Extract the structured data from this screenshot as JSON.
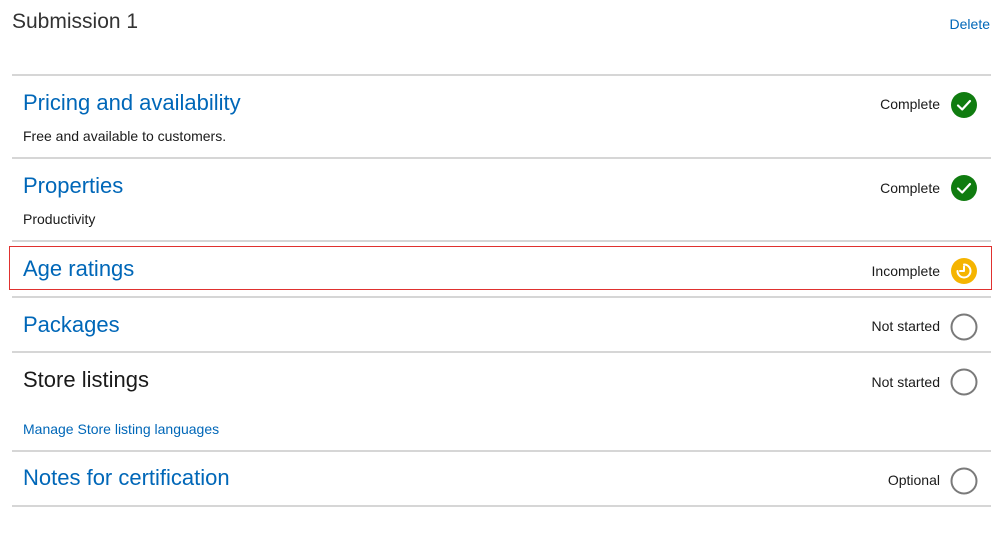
{
  "header": {
    "title": "Submission 1",
    "delete_label": "Delete"
  },
  "sections": [
    {
      "title": "Pricing and availability",
      "subtitle": "Free and available to customers.",
      "status": "Complete",
      "status_icon": "complete-check-icon"
    },
    {
      "title": "Properties",
      "subtitle": "Productivity",
      "status": "Complete",
      "status_icon": "complete-check-icon"
    },
    {
      "title": "Age ratings",
      "status": "Incomplete",
      "status_icon": "incomplete-clock-icon"
    },
    {
      "title": "Packages",
      "status": "Not started",
      "status_icon": "not-started-circle-icon"
    },
    {
      "title": "Store listings",
      "link": "Manage Store listing languages",
      "status": "Not started",
      "status_icon": "not-started-circle-icon"
    },
    {
      "title": "Notes for certification",
      "status": "Optional",
      "status_icon": "optional-circle-icon"
    }
  ],
  "colors": {
    "link": "#0067b8",
    "complete": "#107c10",
    "incomplete": "#f5b400",
    "not_started": "#7a7a7a",
    "highlight": "#e0312f"
  }
}
